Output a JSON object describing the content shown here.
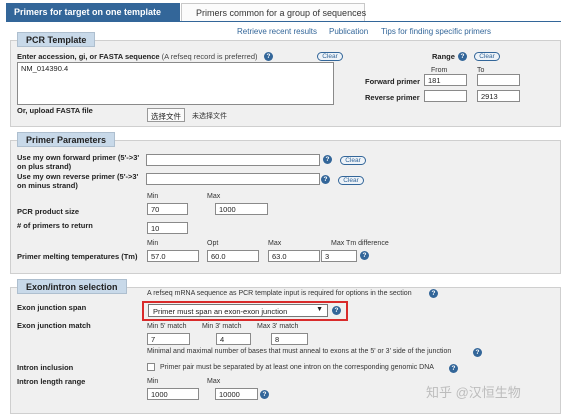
{
  "tabs": {
    "active": "Primers for target on one template",
    "inactive": "Primers common for a group of sequences"
  },
  "top_links": {
    "retrieve": "Retrieve recent results",
    "publication": "Publication",
    "tips": "Tips for finding specific primers"
  },
  "pcr_template": {
    "title": "PCR Template",
    "accession_label": "Enter accession, gi, or FASTA sequence",
    "accession_note": "(A refseq record is preferred)",
    "clear": "Clear",
    "sequence_value": "NM_014390.4",
    "range_label": "Range",
    "range_clear": "Clear",
    "from_label": "From",
    "to_label": "To",
    "forward_primer_label": "Forward primer",
    "forward_from": "181",
    "forward_to": "",
    "reverse_primer_label": "Reverse primer",
    "reverse_from": "",
    "reverse_to": "2913",
    "upload_label": "Or, upload FASTA file",
    "choose_file": "选择文件",
    "no_file": "未选择文件"
  },
  "primer_parameters": {
    "title": "Primer Parameters",
    "own_forward_label": "Use my own forward primer (5'->3' on plus strand)",
    "own_forward_clear": "Clear",
    "own_reverse_label": "Use my own reverse primer (5'->3' on minus strand)",
    "own_reverse_clear": "Clear",
    "min_label": "Min",
    "max_label": "Max",
    "product_size_label": "PCR product size",
    "product_min": "70",
    "product_max": "1000",
    "num_primers_label": "# of primers to return",
    "num_primers": "10",
    "tm_min_label": "Min",
    "tm_opt_label": "Opt",
    "tm_max_label": "Max",
    "tm_diff_label": "Max Tm difference",
    "tm_label": "Primer melting temperatures (Tm)",
    "tm_min": "57.0",
    "tm_opt": "60.0",
    "tm_max": "63.0",
    "tm_diff": "3"
  },
  "exon_intron": {
    "title": "Exon/intron selection",
    "note": "A refseq mRNA sequence as PCR template input is required for options in the section",
    "junction_span_label": "Exon junction span",
    "junction_span_value": "Primer must span an exon-exon junction",
    "junction_match_label": "Exon junction match",
    "min5_label": "Min 5' match",
    "min3_label": "Min 3' match",
    "max3_label": "Max 3' match",
    "min5": "7",
    "min3": "4",
    "max3": "8",
    "match_note": "Minimal and maximal number of bases that must anneal to exons at the 5' or 3' side of the junction",
    "intron_inclusion_label": "Intron inclusion",
    "intron_inclusion_text": "Primer pair must be separated by at least one intron on the corresponding genomic DNA",
    "intron_length_label": "Intron length range",
    "min_label": "Min",
    "max_label": "Max",
    "intron_min": "1000",
    "intron_max": "10000"
  },
  "watermark": "知乎 @汉恒生物",
  "colors": {
    "accent": "#336699",
    "highlight_box": "#d92b2b",
    "section_header": "#c8d9e9"
  }
}
